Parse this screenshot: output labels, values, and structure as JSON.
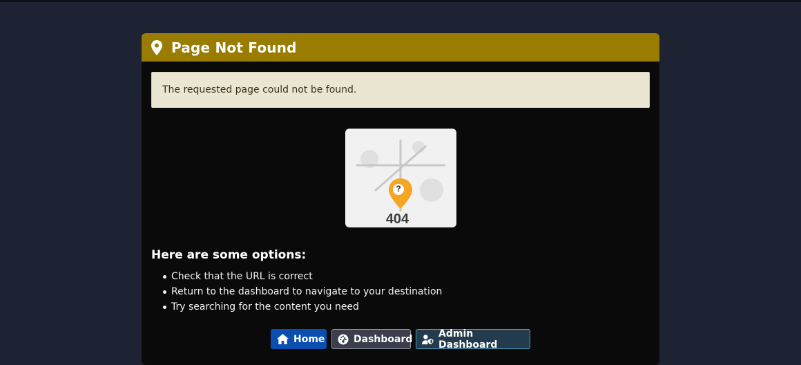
{
  "header": {
    "title": "Page Not Found",
    "icon": "map-marker-icon",
    "color": "#9a7d00"
  },
  "alert": {
    "message": "The requested page could not be found."
  },
  "illustration": {
    "code": "404",
    "marker_label": "?",
    "marker_color": "#f5a623"
  },
  "options": {
    "heading": "Here are some options:",
    "items": [
      "Check that the URL is correct",
      "Return to the dashboard to navigate to your destination",
      "Try searching for the content you need"
    ]
  },
  "buttons": {
    "home": {
      "label": "Home",
      "icon": "home-icon",
      "color": "#0a4fb0"
    },
    "dashboard": {
      "label": "Dashboard",
      "icon": "gauge-icon",
      "color": "#3b3f4d"
    },
    "admin": {
      "label": "Admin Dashboard",
      "icon": "user-shield-icon",
      "color": "#233b4c"
    }
  }
}
